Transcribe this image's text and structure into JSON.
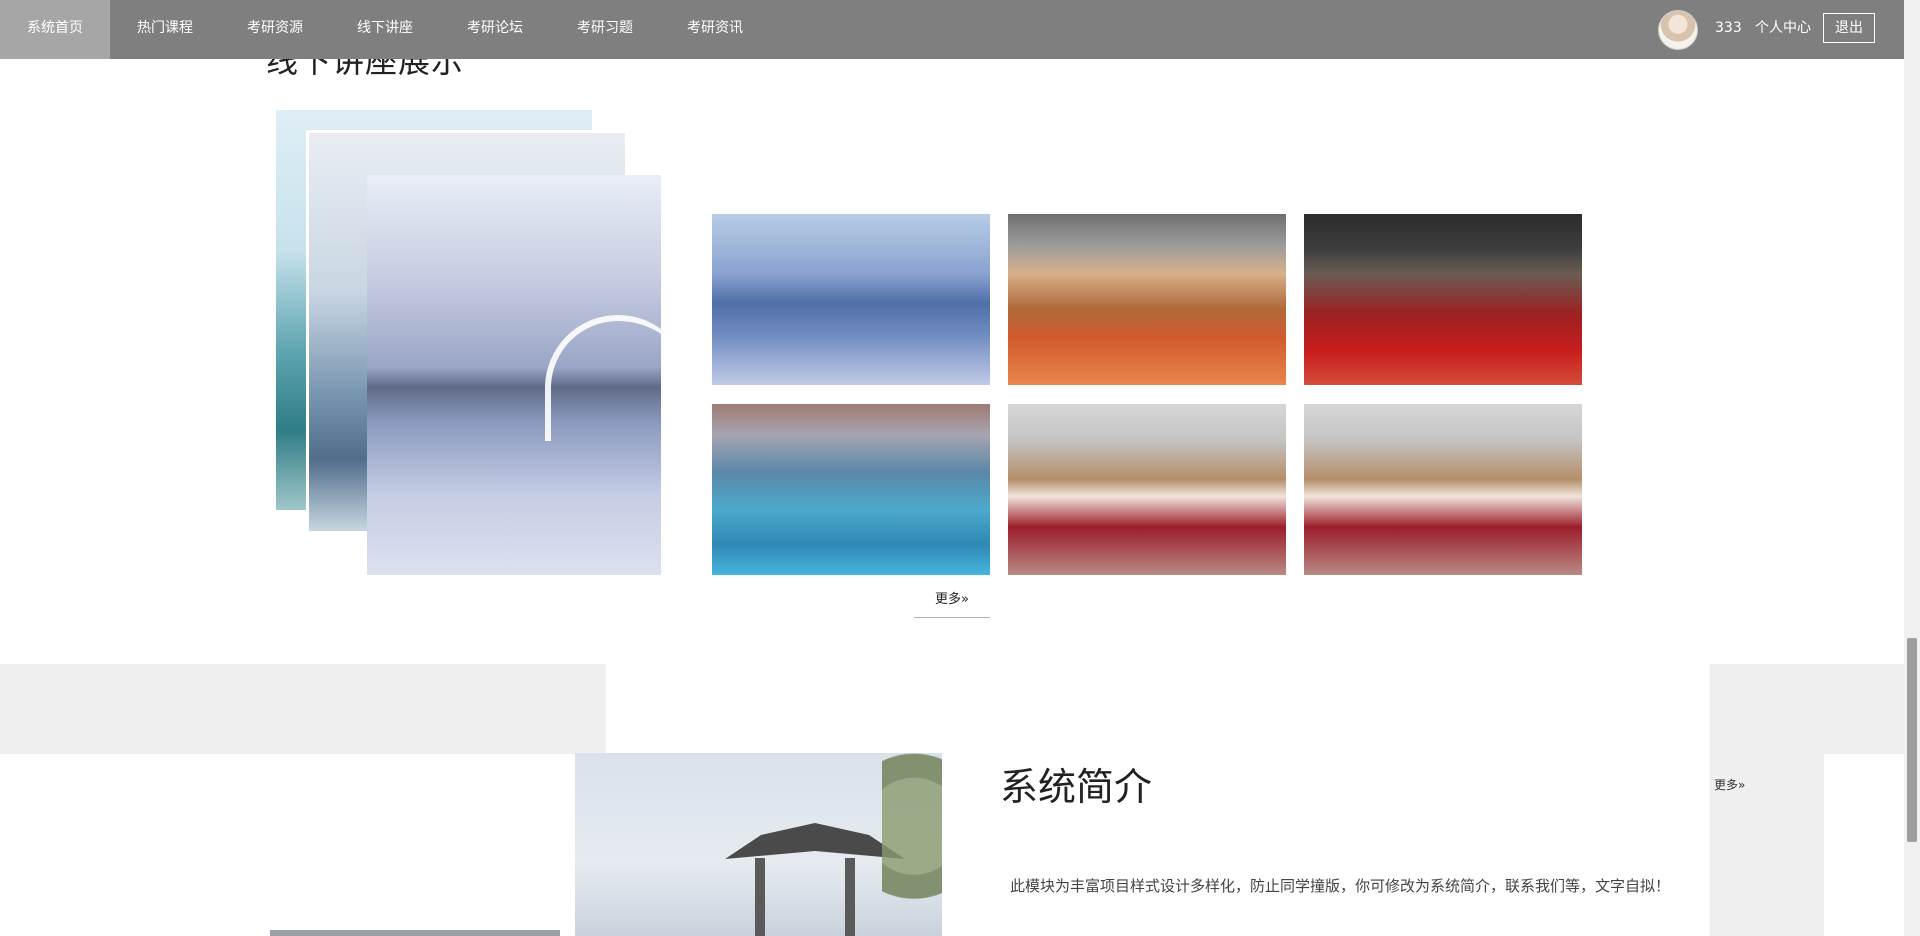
{
  "nav": {
    "items": [
      {
        "label": "系统首页",
        "active": true
      },
      {
        "label": "热门课程",
        "active": false
      },
      {
        "label": "考研资源",
        "active": false
      },
      {
        "label": "线下讲座",
        "active": false
      },
      {
        "label": "考研论坛",
        "active": false
      },
      {
        "label": "考研习题",
        "active": false
      },
      {
        "label": "考研资讯",
        "active": false
      }
    ],
    "username": "333",
    "profile_label": "个人中心",
    "logout_label": "退出"
  },
  "lectures": {
    "title": "线下讲座展示",
    "more_label": "更多»"
  },
  "intro": {
    "title": "系统简介",
    "text": "此模块为丰富项目样式设计多样化，防止同学撞版，你可修改为系统简介，联系我们等，文字自拟！",
    "more_label": "更多»"
  },
  "colors": {
    "nav_bg": "#7f7f7f",
    "nav_active": "#a6a6a6",
    "band_gray": "#efeff0"
  }
}
